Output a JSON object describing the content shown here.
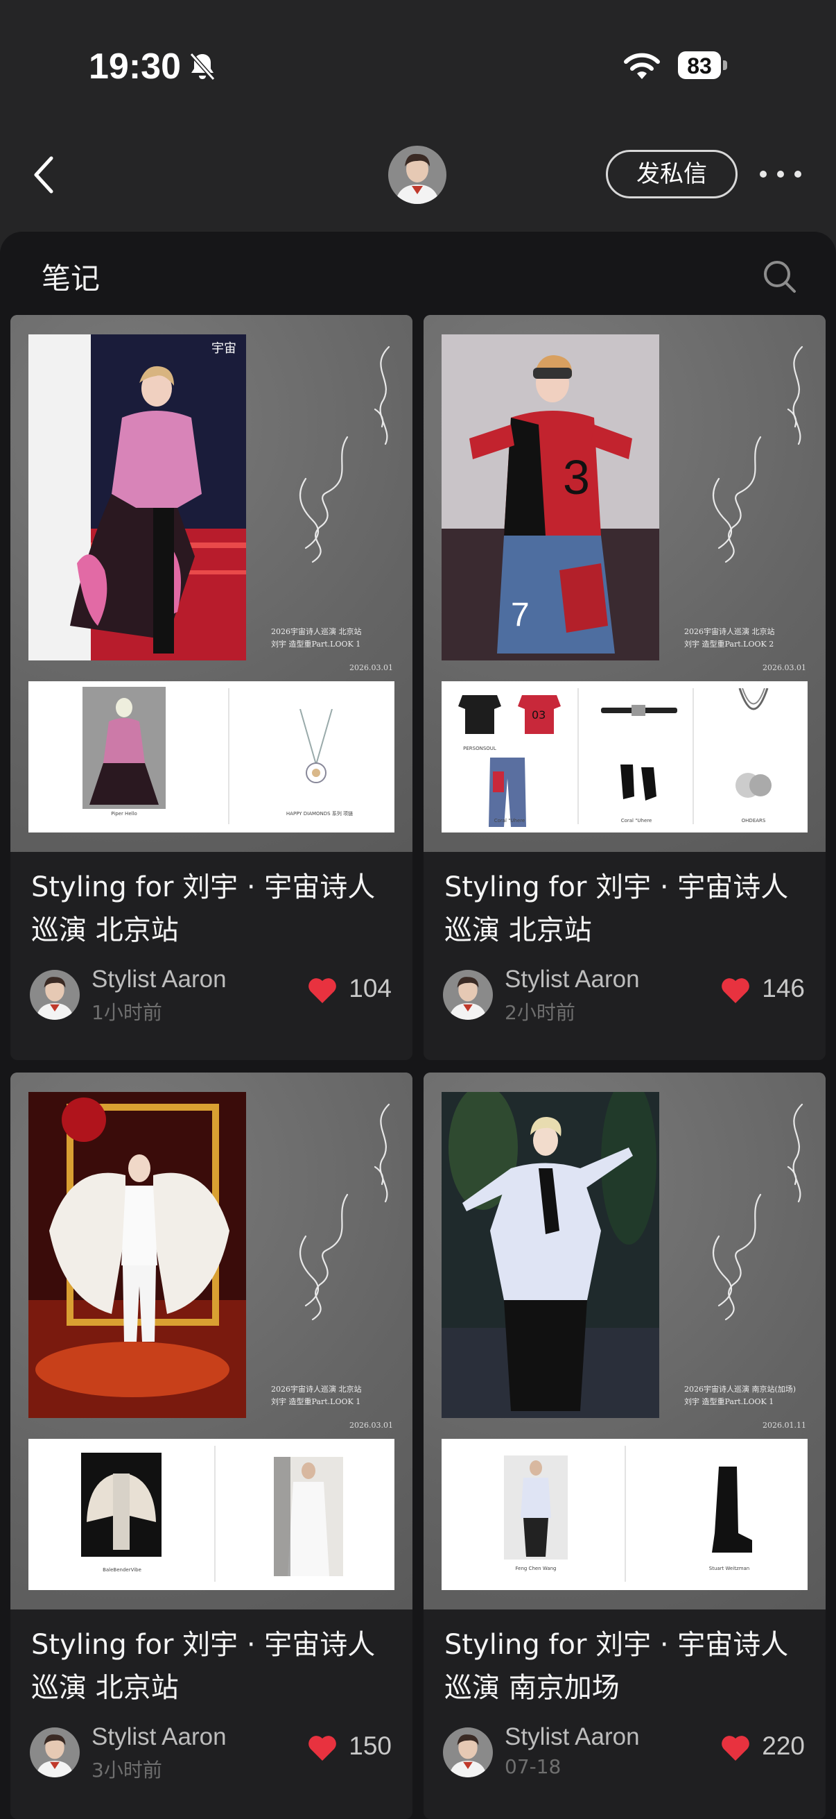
{
  "status_bar": {
    "time": "19:30",
    "battery": "83"
  },
  "nav": {
    "dm_button": "发私信"
  },
  "section": {
    "title": "笔记"
  },
  "colors": {
    "heart": "#e8323f",
    "background": "#161618",
    "card": "#1f1f21"
  },
  "notes": [
    {
      "title": "Styling for 刘宇 · 宇宙诗人巡演 北京站",
      "author": "Stylist Aaron",
      "time": "1小时前",
      "likes": "104",
      "cover_date": "2026.03.01",
      "cover_caption": [
        "2026宇宙诗人巡演 北京站",
        "刘宇 造型重Part.LOOK 1"
      ]
    },
    {
      "title": "Styling for 刘宇 · 宇宙诗人巡演 北京站",
      "author": "Stylist Aaron",
      "time": "2小时前",
      "likes": "146",
      "cover_date": "2026.03.01",
      "cover_caption": [
        "2026宇宙诗人巡演 北京站",
        "刘宇 造型重Part.LOOK 2"
      ]
    },
    {
      "title": "Styling for 刘宇 · 宇宙诗人巡演 北京站",
      "author": "Stylist Aaron",
      "time": "3小时前",
      "likes": "150",
      "cover_date": "2026.03.01",
      "cover_caption": [
        "2026宇宙诗人巡演 北京站",
        "刘宇 造型重Part.LOOK 1"
      ]
    },
    {
      "title": "Styling for 刘宇 · 宇宙诗人巡演 南京加场",
      "author": "Stylist Aaron",
      "time": "07-18",
      "likes": "220",
      "cover_date": "2026.01.11",
      "cover_caption": [
        "2026宇宙诗人巡演 南京站(加场)",
        "刘宇 造型重Part.LOOK 1"
      ]
    }
  ]
}
